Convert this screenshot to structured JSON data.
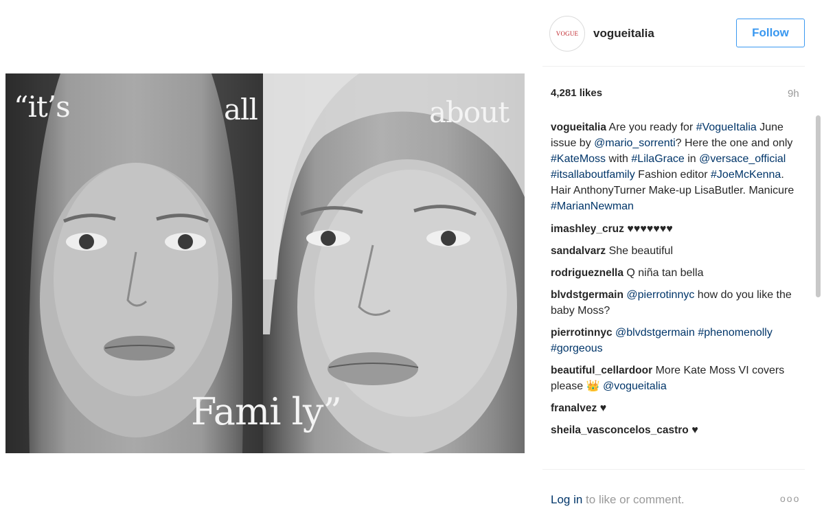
{
  "photo": {
    "words": {
      "its": "“it’s",
      "all": "all",
      "about": "about",
      "family": "Fami ly”"
    }
  },
  "post": {
    "username": "vogueitalia",
    "avatar_text": "VOGUE",
    "follow_label": "Follow",
    "likes": "4,281 likes",
    "time": "9h"
  },
  "caption": {
    "user": "vogueitalia",
    "segments": [
      {
        "text": " Are you ready for ",
        "link": false
      },
      {
        "text": "#VogueItalia",
        "link": true
      },
      {
        "text": " June issue by ",
        "link": false
      },
      {
        "text": "@mario_sorrenti",
        "link": true
      },
      {
        "text": "? Here the one and only ",
        "link": false
      },
      {
        "text": "#KateMoss",
        "link": true
      },
      {
        "text": " with ",
        "link": false
      },
      {
        "text": "#LilaGrace",
        "link": true
      },
      {
        "text": " in ",
        "link": false
      },
      {
        "text": "@versace_official",
        "link": true
      },
      {
        "text": " ",
        "link": false
      },
      {
        "text": "#itsallaboutfamily",
        "link": true
      },
      {
        "text": " Fashion editor ",
        "link": false
      },
      {
        "text": "#JoeMcKenna",
        "link": true
      },
      {
        "text": ". Hair AnthonyTurner Make-up LisaButler. Manicure ",
        "link": false
      },
      {
        "text": "#MarianNewman",
        "link": true
      }
    ]
  },
  "comments": [
    {
      "user": "imashley_cruz",
      "segments": [
        {
          "text": " ♥♥♥♥♥♥♥",
          "link": false
        }
      ]
    },
    {
      "user": "sandalvarz",
      "segments": [
        {
          "text": " She beautiful",
          "link": false
        }
      ]
    },
    {
      "user": "rodrigueznella",
      "segments": [
        {
          "text": " Q niña tan bella",
          "link": false
        }
      ]
    },
    {
      "user": "blvdstgermain",
      "segments": [
        {
          "text": " ",
          "link": false
        },
        {
          "text": "@pierrotinnyc",
          "link": true
        },
        {
          "text": " how do you like the baby Moss?",
          "link": false
        }
      ]
    },
    {
      "user": "pierrotinnyc",
      "segments": [
        {
          "text": " ",
          "link": false
        },
        {
          "text": "@blvdstgermain",
          "link": true
        },
        {
          "text": " ",
          "link": false
        },
        {
          "text": "#phenomenolly",
          "link": true
        },
        {
          "text": " ",
          "link": false
        },
        {
          "text": "#gorgeous",
          "link": true
        }
      ]
    },
    {
      "user": "beautiful_cellardoor",
      "segments": [
        {
          "text": " More Kate Moss VI covers please 👑 ",
          "link": false
        },
        {
          "text": "@vogueitalia",
          "link": true
        }
      ]
    },
    {
      "user": "franalvez",
      "segments": [
        {
          "text": " ♥",
          "link": false
        }
      ]
    },
    {
      "user": "sheila_vasconcelos_castro",
      "segments": [
        {
          "text": " ♥",
          "link": false
        }
      ]
    }
  ],
  "footer": {
    "login_link": "Log in",
    "login_rest": " to like or comment.",
    "more_icon": "ooo"
  },
  "colors": {
    "link": "#003569",
    "follow_blue": "#3897f0",
    "muted": "#999999"
  }
}
